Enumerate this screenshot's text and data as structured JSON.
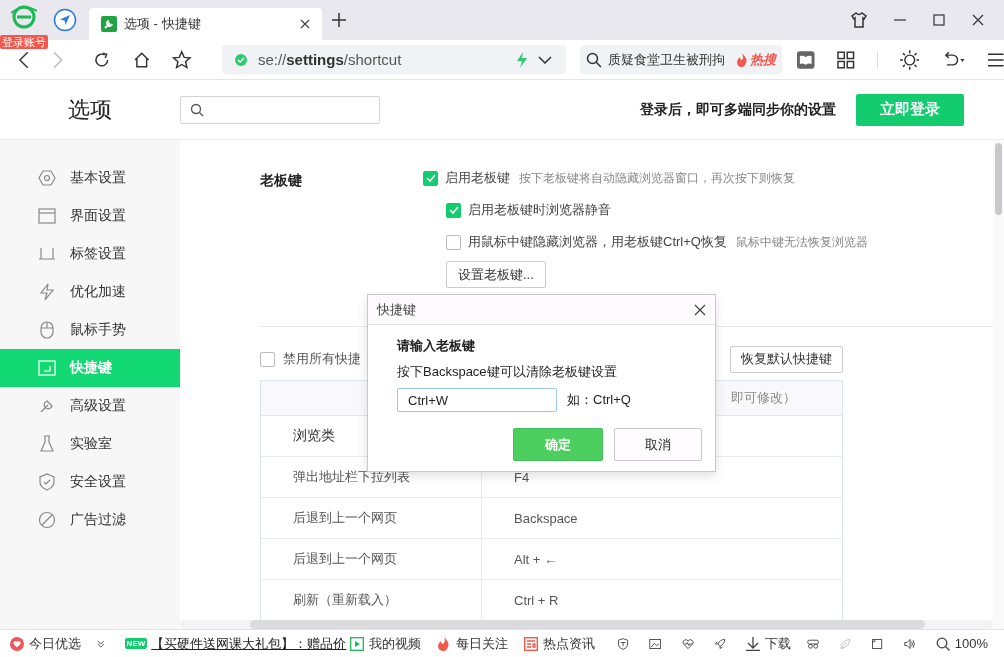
{
  "browser": {
    "account_badge": "登录账号",
    "tabs": [
      {
        "title": "选项 - 快捷键",
        "selected": true
      }
    ],
    "address": {
      "scheme": "se://",
      "host": "settings",
      "path": "/shortcut"
    },
    "search": {
      "value": "质疑食堂卫生被刑拘",
      "hot_label": "热搜"
    }
  },
  "page": {
    "title": "选项",
    "login_prompt": "登录后，即可多端同步你的设置",
    "login_button": "立即登录"
  },
  "sidebar": {
    "items": [
      {
        "label": "基本设置",
        "selected": false
      },
      {
        "label": "界面设置",
        "selected": false
      },
      {
        "label": "标签设置",
        "selected": false
      },
      {
        "label": "优化加速",
        "selected": false
      },
      {
        "label": "鼠标手势",
        "selected": false
      },
      {
        "label": "快捷键",
        "selected": true
      },
      {
        "label": "高级设置",
        "selected": false
      },
      {
        "label": "实验室",
        "selected": false
      },
      {
        "label": "安全设置",
        "selected": false
      },
      {
        "label": "广告过滤",
        "selected": false
      }
    ]
  },
  "boss_key": {
    "label": "老板键",
    "options": [
      {
        "label": "启用老板键",
        "hint": "按下老板键将自动隐藏浏览器窗口，再次按下则恢复",
        "checked": true,
        "children": [
          {
            "label": "启用老板键时浏览器静音",
            "checked": true
          },
          {
            "label": "用鼠标中键隐藏浏览器，用老板键Ctrl+Q恢复",
            "hint": "鼠标中键无法恢复浏览器",
            "checked": false
          }
        ]
      }
    ],
    "button": "设置老板键..."
  },
  "shortcuts": {
    "disable_all": {
      "label": "禁用所有快捷",
      "checked": false
    },
    "restore_button": "恢复默认快捷键",
    "header_tail": "即可修改）",
    "rows": [
      {
        "kind": "category",
        "action": "浏览类"
      },
      {
        "kind": "item",
        "action": "弹出地址栏下拉列表",
        "key": "F4"
      },
      {
        "kind": "item",
        "action": "后退到上一个网页",
        "key": "Backspace"
      },
      {
        "kind": "item",
        "action": "后退到上一个网页",
        "key": "Alt + ←"
      },
      {
        "kind": "item",
        "action": "刷新（重新载入）",
        "key": "Ctrl + R"
      }
    ]
  },
  "dialog": {
    "title": "快捷键",
    "prompt": "请输入老板键",
    "instruction": "按下Backspace键可以清除老板键设置",
    "value": "Ctrl+W",
    "example": "如：Ctrl+Q",
    "ok": "确定",
    "cancel": "取消"
  },
  "status_bar": {
    "items": [
      {
        "kind": "heart",
        "label": "今日优选"
      },
      {
        "kind": "promo",
        "badge": "NEW",
        "label": "【买硬件送网课大礼包】：赠品价"
      },
      {
        "kind": "video",
        "label": "我的视频"
      },
      {
        "kind": "flame",
        "label": "每日关注"
      },
      {
        "kind": "news",
        "label": "热点资讯"
      },
      {
        "kind": "download",
        "label": "下载"
      },
      {
        "kind": "zoom",
        "label": "100%"
      }
    ]
  }
}
